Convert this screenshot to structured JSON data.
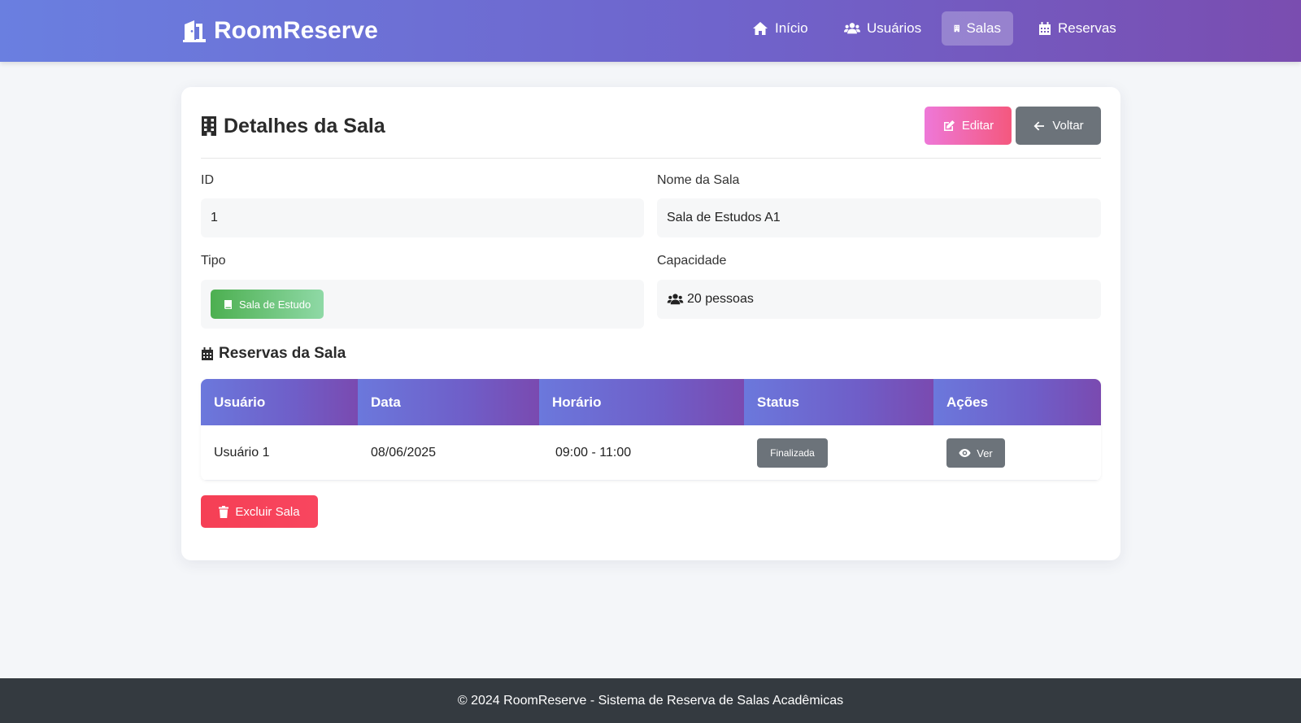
{
  "app": {
    "brand": "RoomReserve",
    "accent_gradient": [
      "#6a7fe0",
      "#7a4db0"
    ]
  },
  "nav": {
    "items": [
      {
        "label": "Início",
        "icon": "home-icon"
      },
      {
        "label": "Usuários",
        "icon": "users-icon"
      },
      {
        "label": "Salas",
        "icon": "building-icon",
        "active": true
      },
      {
        "label": "Reservas",
        "icon": "calendar-icon"
      }
    ]
  },
  "page": {
    "title": "Detalhes da Sala",
    "edit_label": "Editar",
    "back_label": "Voltar"
  },
  "fields": {
    "id_label": "ID",
    "id_value": "1",
    "name_label": "Nome da Sala",
    "name_value": "Sala de Estudos A1",
    "type_label": "Tipo",
    "type_value": "Sala de Estudo",
    "capacity_label": "Capacidade",
    "capacity_value": "20 pessoas"
  },
  "reservations": {
    "title": "Reservas da Sala",
    "columns": [
      "Usuário",
      "Data",
      "Horário",
      "Status",
      "Ações"
    ],
    "rows": [
      {
        "user": "Usuário 1",
        "date": "08/06/2025",
        "time": "09:00 - 11:00",
        "status": "Finalizada",
        "action": "Ver"
      }
    ]
  },
  "delete_label": "Excluir Sala",
  "footer": {
    "text": "© 2024 RoomReserve - Sistema de Reserva de Salas Acadêmicas"
  },
  "colors": {
    "edit_button": "#f4587e",
    "back_button": "#6c737a",
    "delete_button": "#f53f55",
    "type_badge": "#4caf50",
    "status_badge": "#6c737a",
    "footer_bg": "#343a40"
  }
}
